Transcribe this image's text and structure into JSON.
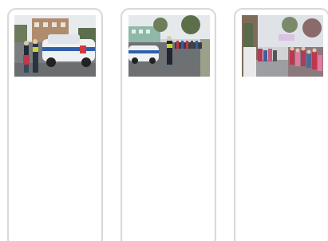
{
  "gallery": {
    "items": [
      {
        "id": "photo-1",
        "icon": "photo-thumbnail-icon"
      },
      {
        "id": "photo-2",
        "icon": "photo-thumbnail-icon"
      },
      {
        "id": "photo-3",
        "icon": "photo-thumbnail-icon"
      }
    ]
  },
  "colors": {
    "card_border": "#d9d9d9",
    "card_bottom_bar": "#d6d6d6"
  }
}
